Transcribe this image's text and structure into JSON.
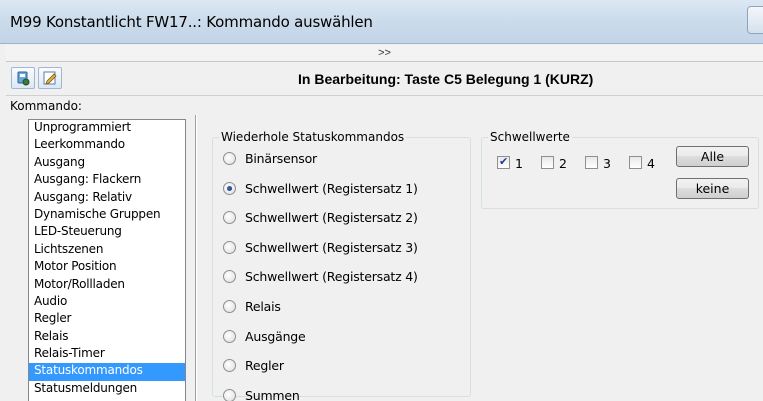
{
  "window": {
    "title": "M99 Konstantlicht FW17..: Kommando auswählen"
  },
  "expander": {
    "label": ">>"
  },
  "toolbar": {
    "status_text": "In Bearbeitung: Taste C5 Belegung 1 (KURZ)",
    "buttons": [
      {
        "icon": "settings-icon"
      },
      {
        "icon": "edit-icon"
      }
    ]
  },
  "kommando": {
    "label": "Kommando:",
    "items": [
      "Unprogrammiert",
      "Leerkommando",
      "Ausgang",
      "Ausgang: Flackern",
      "Ausgang: Relativ",
      "Dynamische Gruppen",
      "LED-Steuerung",
      "Lichtszenen",
      "Motor Position",
      "Motor/Rollladen",
      "Audio",
      "Regler",
      "Relais",
      "Relais-Timer",
      "Statuskommandos",
      "Statusmeldungen"
    ],
    "selected": "Statuskommandos"
  },
  "repeat": {
    "legend": "Wiederhole Statuskommandos",
    "options": [
      "Binärsensor",
      "Schwellwert (Registersatz 1)",
      "Schwellwert (Registersatz 2)",
      "Schwellwert (Registersatz 3)",
      "Schwellwert (Registersatz 4)",
      "Relais",
      "Ausgänge",
      "Regler",
      "Summen"
    ],
    "selected": "Schwellwert (Registersatz 1)"
  },
  "thresholds": {
    "legend": "Schwellwerte",
    "checkboxes": [
      {
        "label": "1",
        "checked": true
      },
      {
        "label": "2",
        "checked": false
      },
      {
        "label": "3",
        "checked": false
      },
      {
        "label": "4",
        "checked": false
      }
    ],
    "all_label": "Alle",
    "none_label": "keine"
  }
}
